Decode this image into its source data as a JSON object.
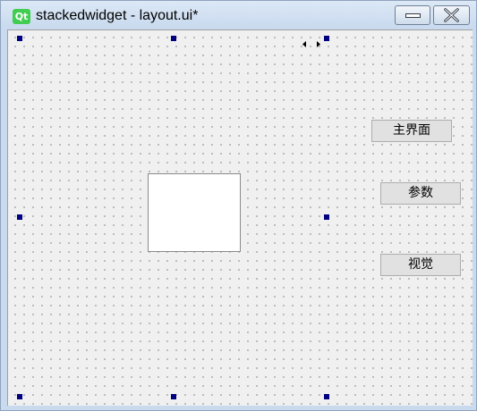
{
  "window": {
    "app_icon": "qt-logo-icon",
    "logo_text": "Qt",
    "title": "stackedwidget - layout.ui*",
    "controls": [
      "minimize-icon",
      "close-icon"
    ]
  },
  "form": {
    "grid": "dotted",
    "selection_handles": 8,
    "resize_cursor_icon": "horizontal-resize-arrows-icon",
    "buttons": {
      "main": "主界面",
      "params": "参数",
      "vision": "视觉"
    }
  },
  "colors": {
    "titlebar": "#c8d9ee",
    "canvas": "#f0f0f0",
    "handle": "#000080",
    "button": "#e1e1e1",
    "qt_green": "#41cd52"
  }
}
